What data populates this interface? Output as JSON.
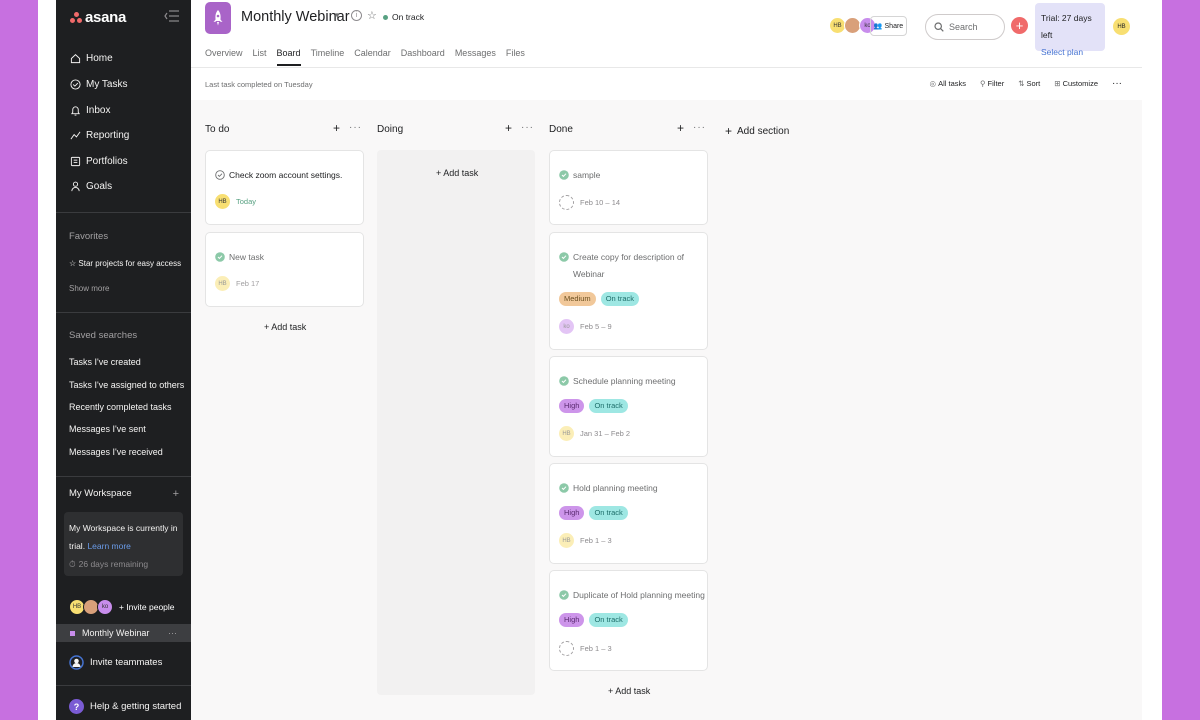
{
  "sidebar": {
    "logo": "asana",
    "nav": [
      {
        "label": "Home",
        "icon": "home-icon"
      },
      {
        "label": "My Tasks",
        "icon": "check-circle-icon"
      },
      {
        "label": "Inbox",
        "icon": "bell-icon"
      },
      {
        "label": "Reporting",
        "icon": "trend-icon"
      },
      {
        "label": "Portfolios",
        "icon": "folder-icon"
      },
      {
        "label": "Goals",
        "icon": "person-icon"
      }
    ],
    "favorites": {
      "heading": "Favorites",
      "star_text": "Star projects for easy access",
      "show_more": "Show more"
    },
    "saved_searches": {
      "heading": "Saved searches",
      "items": [
        "Tasks I've created",
        "Tasks I've assigned to others",
        "Recently completed tasks",
        "Messages I've sent",
        "Messages I've received"
      ]
    },
    "workspace": {
      "heading": "My Workspace",
      "trial_line1": "My Workspace is currently in",
      "trial_line2": "trial.",
      "learn_more": "Learn more",
      "remaining": "26 days remaining"
    },
    "members": [
      {
        "initials": "HB",
        "color": "#f8df72"
      },
      {
        "initials": "",
        "color": "#d9a07a"
      },
      {
        "initials": "ko",
        "color": "#c88dec"
      }
    ],
    "invite_people": "+ Invite people",
    "project": "Monthly Webinar",
    "project_dots": "···",
    "invite_teammates": "Invite teammates",
    "help": "Help & getting started"
  },
  "header": {
    "title": "Monthly Webinar",
    "status": "On track",
    "status_color": "#58a182",
    "tabs": [
      "Overview",
      "List",
      "Board",
      "Timeline",
      "Calendar",
      "Dashboard",
      "Messages",
      "Files"
    ],
    "active_tab": "Board",
    "avatars": [
      {
        "initials": "HB",
        "color": "#f8df72"
      },
      {
        "initials": "",
        "color": "#d9a07a"
      },
      {
        "initials": "ko",
        "color": "#c88dec"
      }
    ],
    "share": "Share",
    "search_placeholder": "Search",
    "trial": "Trial: 27 days left",
    "select_plan": "Select plan",
    "me_initials": "HB"
  },
  "subbar": {
    "last_task": "Last task completed on Tuesday",
    "tools": [
      "All tasks",
      "Filter",
      "Sort",
      "Customize"
    ],
    "more": "···"
  },
  "board": {
    "add_section": "Add section",
    "add_task": "Add task",
    "columns": [
      {
        "name": "To do",
        "cards": [
          {
            "title_lines": [
              "Check zoom account settings."
            ],
            "done": false,
            "assignee": "HB",
            "assignee_color": "#f8df72",
            "date": "Today",
            "date_color": "#58a182",
            "tags": []
          },
          {
            "title_lines": [
              "New task"
            ],
            "done": true,
            "assignee": "HB",
            "assignee_color": "#f8df72",
            "date": "Feb 17",
            "date_color": "#a2a0a2",
            "tags": []
          }
        ]
      },
      {
        "name": "Doing",
        "cards": []
      },
      {
        "name": "Done",
        "cards": [
          {
            "title_lines": [
              "sample"
            ],
            "done": true,
            "assignee": "",
            "assignee_color": "",
            "date": "Feb 10 – 14",
            "date_color": "#a2a0a2",
            "tags": []
          },
          {
            "title_lines": [
              "Create copy for description of",
              "Webinar"
            ],
            "done": true,
            "assignee": "ko",
            "assignee_color": "#c88dec",
            "date": "Feb 5 – 9",
            "date_color": "#a2a0a2",
            "tags": [
              {
                "label": "Medium",
                "color": "#f1c89a"
              },
              {
                "label": "On track",
                "color": "#9ee7e3"
              }
            ]
          },
          {
            "title_lines": [
              "Schedule planning meeting"
            ],
            "done": true,
            "assignee": "HB",
            "assignee_color": "#f8df72",
            "date": "Jan 31 – Feb 2",
            "date_color": "#a2a0a2",
            "tags": [
              {
                "label": "High",
                "color": "#cd95ea"
              },
              {
                "label": "On track",
                "color": "#9ee7e3"
              }
            ]
          },
          {
            "title_lines": [
              "Hold planning meeting"
            ],
            "done": true,
            "assignee": "HB",
            "assignee_color": "#f8df72",
            "date": "Feb 1 – 3",
            "date_color": "#a2a0a2",
            "tags": [
              {
                "label": "High",
                "color": "#cd95ea"
              },
              {
                "label": "On track",
                "color": "#9ee7e3"
              }
            ]
          },
          {
            "title_lines": [
              "Duplicate of Hold planning meeting"
            ],
            "done": true,
            "assignee": "",
            "assignee_color": "",
            "date": "Feb 1 – 3",
            "date_color": "#a2a0a2",
            "tags": [
              {
                "label": "High",
                "color": "#cd95ea"
              },
              {
                "label": "On track",
                "color": "#9ee7e3"
              }
            ]
          }
        ]
      }
    ]
  }
}
